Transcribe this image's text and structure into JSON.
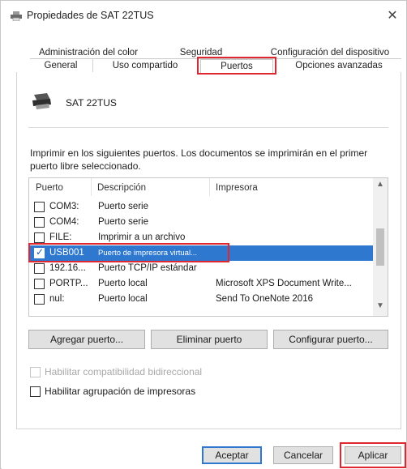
{
  "window": {
    "title": "Propiedades de SAT 22TUS",
    "close_glyph": "✕"
  },
  "tabs": {
    "row1": [
      "Administración del color",
      "Seguridad",
      "Configuración del dispositivo"
    ],
    "row2": [
      "General",
      "Uso compartido",
      "Puertos",
      "Opciones avanzadas"
    ],
    "active": "Puertos"
  },
  "printer": {
    "name": "SAT 22TUS",
    "icon": "printer-icon"
  },
  "instruction": "Imprimir en los siguientes puertos. Los documentos se imprimirán en el primer puerto libre seleccionado.",
  "ports_list": {
    "headers": [
      "Puerto",
      "Descripción",
      "Impresora"
    ],
    "rows": [
      {
        "port": "COM3:",
        "description": "Puerto serie",
        "printer": "",
        "checked": false,
        "selected": false
      },
      {
        "port": "COM4:",
        "description": "Puerto serie",
        "printer": "",
        "checked": false,
        "selected": false
      },
      {
        "port": "FILE:",
        "description": "Imprimir a un archivo",
        "printer": "",
        "checked": false,
        "selected": false
      },
      {
        "port": "USB001",
        "description": "Puerto de impresora virtual...",
        "printer": "",
        "checked": true,
        "selected": true
      },
      {
        "port": "192.16...",
        "description": "Puerto TCP/IP estándar",
        "printer": "",
        "checked": false,
        "selected": false
      },
      {
        "port": "PORTP...",
        "description": "Puerto local",
        "printer": "Microsoft XPS Document Write...",
        "checked": false,
        "selected": false
      },
      {
        "port": "nul:",
        "description": "Puerto local",
        "printer": "Send To OneNote 2016",
        "checked": false,
        "selected": false
      }
    ]
  },
  "port_buttons": {
    "add": "Agregar puerto...",
    "delete": "Eliminar puerto",
    "configure": "Configurar puerto..."
  },
  "options": {
    "bidirectional": {
      "label": "Habilitar compatibilidad bidireccional",
      "checked": false,
      "disabled": true
    },
    "pooling": {
      "label": "Habilitar agrupación de impresoras",
      "checked": false,
      "disabled": false
    }
  },
  "footer": {
    "accept": "Aceptar",
    "cancel": "Cancelar",
    "apply": "Aplicar"
  },
  "colors": {
    "highlight_red": "#e0262e",
    "selection_blue": "#2e78cf"
  }
}
